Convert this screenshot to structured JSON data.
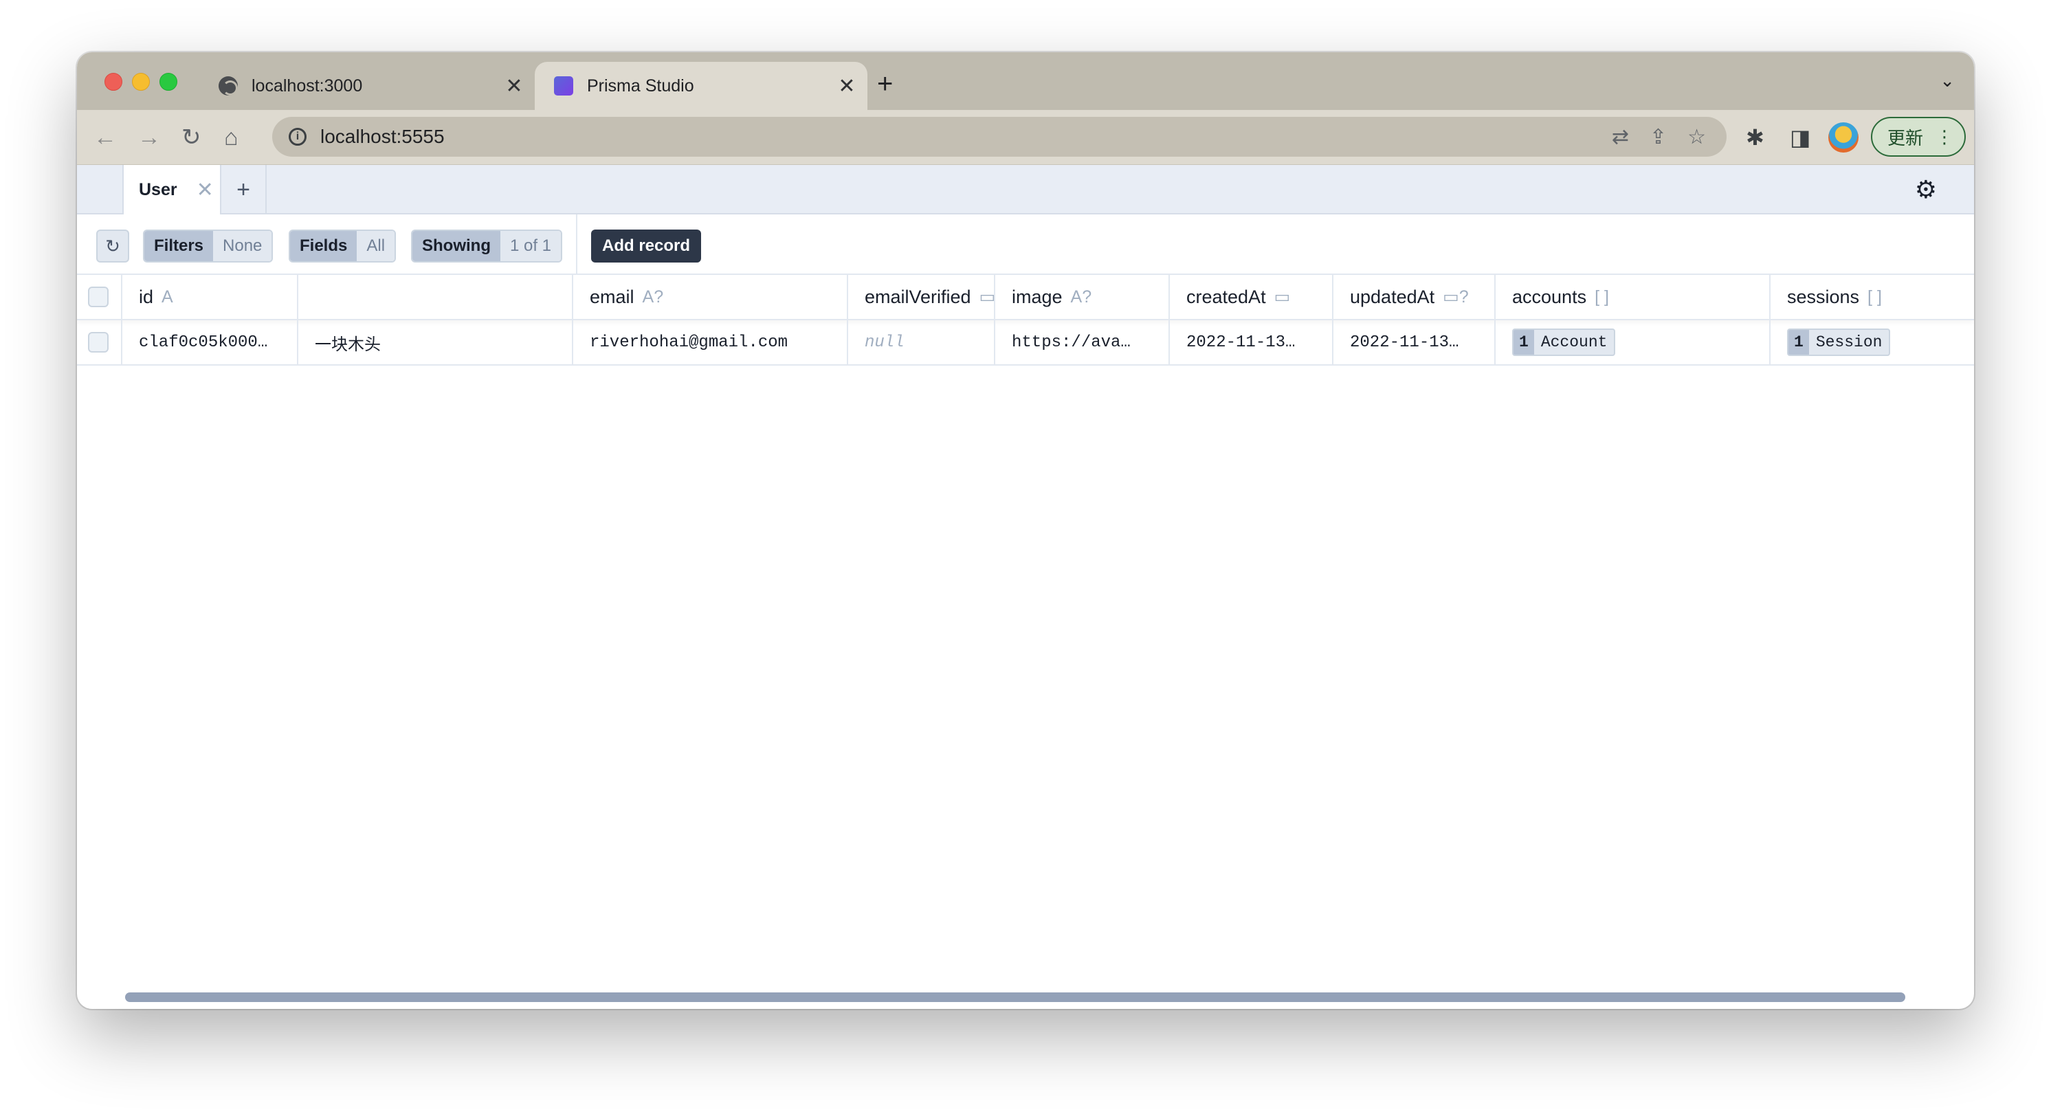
{
  "browser": {
    "tabs": [
      {
        "title": "localhost:3000",
        "icon": "globe-icon"
      },
      {
        "title": "Prisma Studio",
        "icon": "prisma-icon"
      }
    ],
    "address": "localhost:5555",
    "update_label": "更新"
  },
  "studio": {
    "model_tab": "User",
    "actions": {
      "filters_label": "Filters",
      "filters_value": "None",
      "fields_label": "Fields",
      "fields_value": "All",
      "showing_label": "Showing",
      "showing_value": "1 of 1",
      "add_record": "Add record"
    },
    "columns": [
      {
        "name": "id",
        "type": "A"
      },
      {
        "name": "",
        "type": ""
      },
      {
        "name": "email",
        "type": "A?"
      },
      {
        "name": "emailVerified",
        "type": "▭"
      },
      {
        "name": "image",
        "type": "A?"
      },
      {
        "name": "createdAt",
        "type": "▭"
      },
      {
        "name": "updatedAt",
        "type": "▭?"
      },
      {
        "name": "accounts",
        "type": "[ ]"
      },
      {
        "name": "sessions",
        "type": "[ ]"
      }
    ],
    "rows": [
      {
        "id": "claf0c05k000…",
        "name": "一块木头",
        "email": "riverhohai@gmail.com",
        "emailVerified": "null",
        "image": "https://ava…",
        "createdAt": "2022-11-13…",
        "updatedAt": "2022-11-13…",
        "accounts": {
          "count": "1",
          "label": "Account"
        },
        "sessions": {
          "count": "1",
          "label": "Session"
        }
      }
    ]
  }
}
